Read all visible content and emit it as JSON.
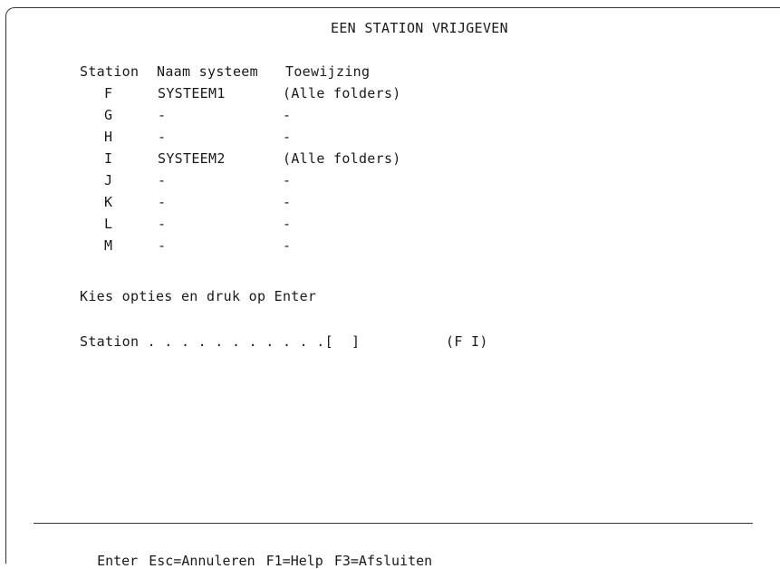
{
  "title": "EEN STATION VRIJGEVEN",
  "table": {
    "headers": {
      "station": "Station",
      "name": "Naam systeem",
      "assignment": "Toewijzing"
    },
    "rows": [
      {
        "station": "F",
        "name": "SYSTEEM1",
        "assignment": "(Alle folders)"
      },
      {
        "station": "G",
        "name": "-",
        "assignment": "-"
      },
      {
        "station": "H",
        "name": "-",
        "assignment": "-"
      },
      {
        "station": "I",
        "name": "SYSTEEM2",
        "assignment": "(Alle folders)"
      },
      {
        "station": "J",
        "name": "-",
        "assignment": "-"
      },
      {
        "station": "K",
        "name": "-",
        "assignment": "-"
      },
      {
        "station": "L",
        "name": "-",
        "assignment": "-"
      },
      {
        "station": "M",
        "name": "-",
        "assignment": "-"
      }
    ]
  },
  "prompt": "Kies opties en druk op Enter",
  "field": {
    "label": "Station . . . . . . . . . . .[",
    "close": "]",
    "value": "",
    "hint": "(F I)"
  },
  "function_keys": [
    "Enter",
    "Esc=Annuleren",
    "F1=Help",
    "F3=Afsluiten"
  ]
}
